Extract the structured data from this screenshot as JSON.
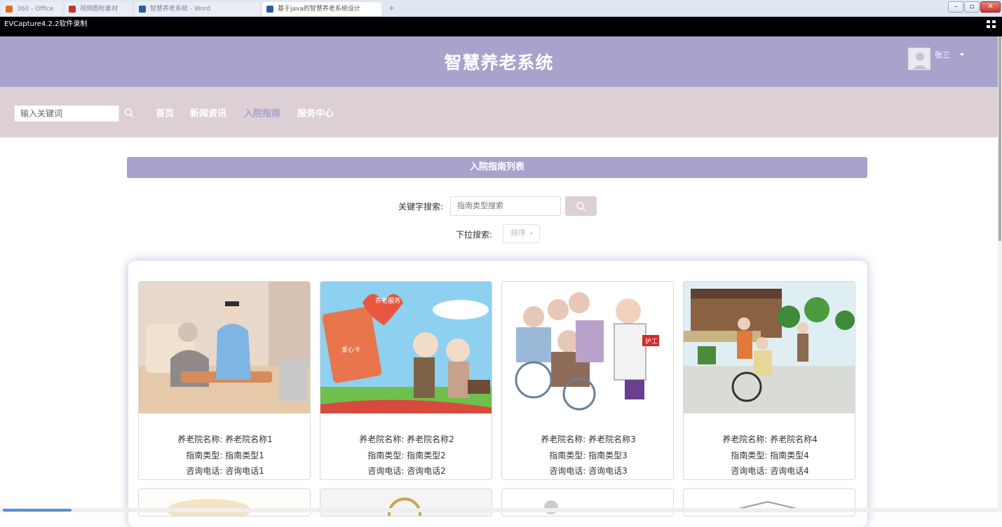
{
  "browser": {
    "tabs": [
      {
        "label": "360 - Office",
        "active": false,
        "color": "#e46b2c"
      },
      {
        "label": "视频图标素材",
        "active": false,
        "color": "#c0392b"
      },
      {
        "label": "智慧养老系统 - Word",
        "active": false,
        "color": "#2b5cad"
      },
      {
        "label": "基于java的智慧养老系统设计",
        "active": true,
        "color": "#2b5cad"
      }
    ]
  },
  "capture": {
    "label": "EVCapture4.2.2软件录制"
  },
  "header": {
    "title": "智慧养老系统",
    "username": "张三"
  },
  "nav": {
    "search_placeholder": "输入关键词",
    "items": [
      "首页",
      "新闻资讯",
      "入院指南",
      "服务中心"
    ],
    "active_index": 2
  },
  "list": {
    "title": "入院指南列表",
    "keyword_label": "关键字搜索:",
    "keyword_placeholder": "指南类型搜索",
    "dropdown_label": "下拉搜索:",
    "dropdown_value": "排序"
  },
  "cards": [
    {
      "name_label": "养老院名称:",
      "name": "养老院名称1",
      "type_label": "指南类型:",
      "type": "指南类型1",
      "phone_label": "咨询电话:",
      "phone": "咨询电话1"
    },
    {
      "name_label": "养老院名称:",
      "name": "养老院名称2",
      "type_label": "指南类型:",
      "type": "指南类型2",
      "phone_label": "咨询电话:",
      "phone": "咨询电话2",
      "badge1": "养老服务",
      "badge2": "爱心卡"
    },
    {
      "name_label": "养老院名称:",
      "name": "养老院名称3",
      "type_label": "指南类型:",
      "type": "指南类型3",
      "phone_label": "咨询电话:",
      "phone": "咨询电话3",
      "badge1": "护工"
    },
    {
      "name_label": "养老院名称:",
      "name": "养老院名称4",
      "type_label": "指南类型:",
      "type": "指南类型4",
      "phone_label": "咨询电话:",
      "phone": "咨询电话4"
    }
  ],
  "colors": {
    "accent": "#a8a2cc",
    "nav_bg": "#dcd0d6"
  }
}
